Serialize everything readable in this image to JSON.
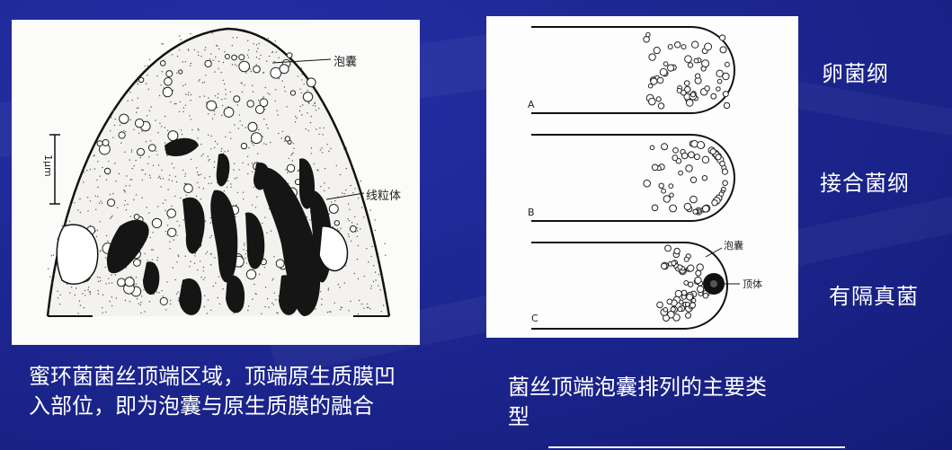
{
  "slide": {
    "left_figure": {
      "label_vesicle": "泡囊",
      "label_mitochondria": "线粒体",
      "scale_label": "1μm"
    },
    "right_figure": {
      "label_a": "A",
      "label_b": "B",
      "label_c": "C",
      "label_vesicle": "泡囊",
      "label_apical_body": "顶体"
    },
    "side_labels": [
      "卵菌纲",
      "接合菌纲",
      "有隔真菌"
    ],
    "caption_left": "蜜环菌菌丝顶端区域，顶端原生质膜凹入部位，即为泡囊与原生质膜的融合",
    "caption_right": "菌丝顶端泡囊排列的主要类型"
  },
  "colors": {
    "background": "#1c2690",
    "text": "#ffffff",
    "figure_ink": "#1a1a1a"
  }
}
